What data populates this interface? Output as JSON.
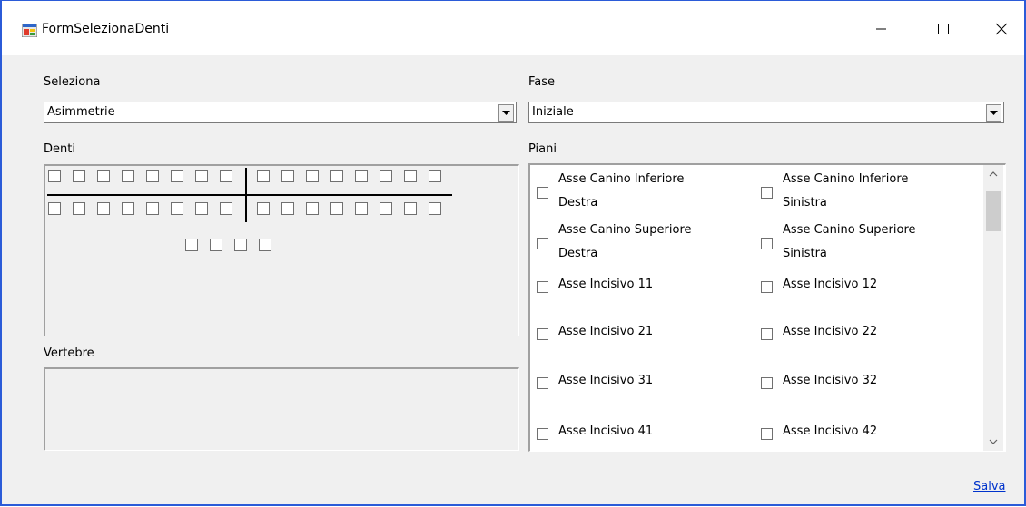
{
  "window": {
    "title": "FormSelezionaDenti"
  },
  "seleziona": {
    "label": "Seleziona",
    "value": "Asimmetrie"
  },
  "fase": {
    "label": "Fase",
    "value": "Iniziale"
  },
  "denti": {
    "label": "Denti",
    "upper_count": 16,
    "lower_count": 16,
    "extra_count": 4
  },
  "vertebre": {
    "label": "Vertebre"
  },
  "piani": {
    "label": "Piani",
    "items": [
      [
        "Asse Canino Inferiore",
        "Destra"
      ],
      [
        "Asse Canino Inferiore",
        "Sinistra"
      ],
      [
        "Asse Canino Superiore",
        "Destra"
      ],
      [
        "Asse Canino Superiore",
        "Sinistra"
      ],
      [
        "Asse Incisivo 11"
      ],
      [
        "Asse Incisivo 12"
      ],
      [
        "Asse Incisivo 21"
      ],
      [
        "Asse Incisivo 22"
      ],
      [
        "Asse Incisivo 31"
      ],
      [
        "Asse Incisivo 32"
      ],
      [
        "Asse Incisivo 41"
      ],
      [
        "Asse Incisivo 42"
      ]
    ]
  },
  "save_link": "Salva",
  "icons": {
    "app": "form-icon",
    "minimize": "minimize-icon",
    "maximize": "maximize-icon",
    "close": "close-icon"
  }
}
